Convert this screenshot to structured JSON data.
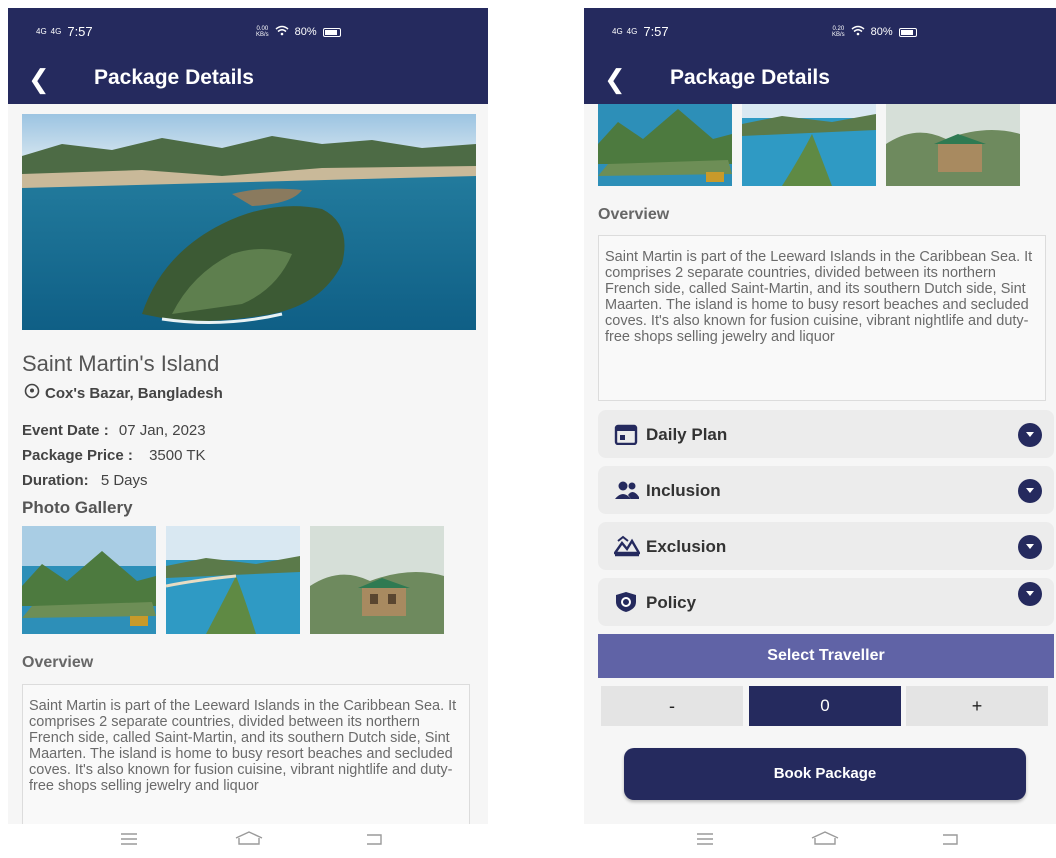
{
  "status": {
    "signal1": "4G",
    "signal2": "4G",
    "time": "7:57",
    "speed_left": "0.00",
    "speed_right": "0.20",
    "speed_unit": "KB/s",
    "battery": "80%"
  },
  "appbar": {
    "back_icon": "back-arrow-icon",
    "back_glyph": "❮",
    "title": "Package Details"
  },
  "package": {
    "name": "Saint Martin's Island",
    "location": "Cox's Bazar, Bangladesh",
    "event_date_label": "Event Date :",
    "event_date_value": "07 Jan, 2023",
    "price_label": "Package Price :",
    "price_value": "3500 TK",
    "duration_label": "Duration:",
    "duration_value": "5 Days"
  },
  "gallery": {
    "title": "Photo Gallery"
  },
  "overview": {
    "title": "Overview",
    "text": "Saint Martin is part of the Leeward Islands in the Caribbean Sea. It comprises 2 separate countries, divided between its northern French side, called Saint-Martin, and its southern Dutch side, Sint Maarten. The island is home to busy resort beaches and secluded coves. It's also known for fusion cuisine, vibrant nightlife and duty-free shops selling jewelry and liquor"
  },
  "accordion": [
    {
      "label": "Daily Plan",
      "icon": "calendar-icon"
    },
    {
      "label": "Inclusion",
      "icon": "people-icon"
    },
    {
      "label": "Exclusion",
      "icon": "landscape-icon"
    },
    {
      "label": "Policy",
      "icon": "shield-icon"
    }
  ],
  "traveller": {
    "title": "Select Traveller",
    "minus": "-",
    "count": "0",
    "plus": "+"
  },
  "book_button": "Book Package",
  "navbar": {
    "menu_icon": "menu-icon",
    "home_icon": "home-icon",
    "back_icon": "back-icon"
  },
  "colors": {
    "primary": "#252a5e",
    "accent": "#6063a6",
    "background": "#f6f6f6"
  }
}
